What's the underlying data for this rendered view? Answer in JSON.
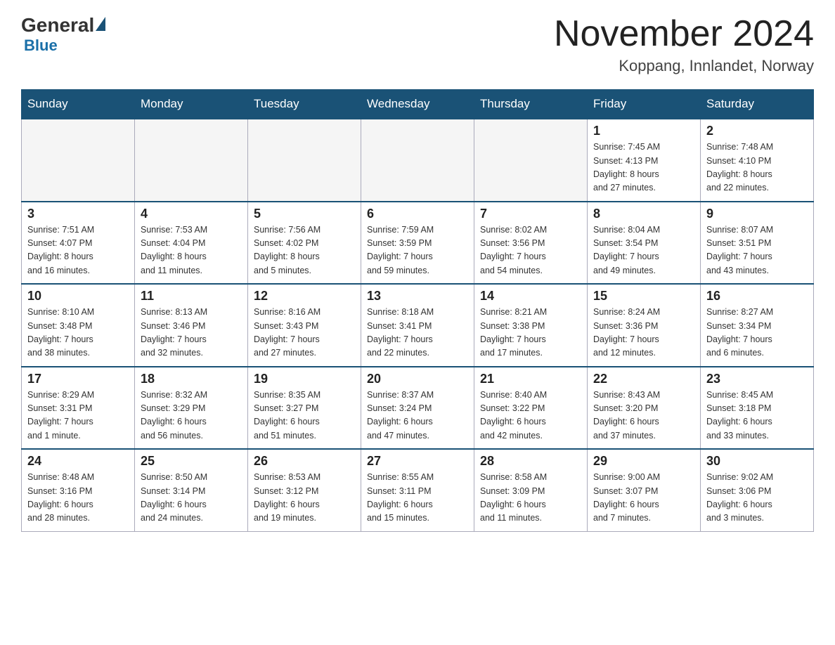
{
  "header": {
    "logo_general": "General",
    "logo_blue": "Blue",
    "title": "November 2024",
    "subtitle": "Koppang, Innlandet, Norway"
  },
  "days_of_week": [
    "Sunday",
    "Monday",
    "Tuesday",
    "Wednesday",
    "Thursday",
    "Friday",
    "Saturday"
  ],
  "weeks": [
    [
      {
        "day": "",
        "info": ""
      },
      {
        "day": "",
        "info": ""
      },
      {
        "day": "",
        "info": ""
      },
      {
        "day": "",
        "info": ""
      },
      {
        "day": "",
        "info": ""
      },
      {
        "day": "1",
        "info": "Sunrise: 7:45 AM\nSunset: 4:13 PM\nDaylight: 8 hours\nand 27 minutes."
      },
      {
        "day": "2",
        "info": "Sunrise: 7:48 AM\nSunset: 4:10 PM\nDaylight: 8 hours\nand 22 minutes."
      }
    ],
    [
      {
        "day": "3",
        "info": "Sunrise: 7:51 AM\nSunset: 4:07 PM\nDaylight: 8 hours\nand 16 minutes."
      },
      {
        "day": "4",
        "info": "Sunrise: 7:53 AM\nSunset: 4:04 PM\nDaylight: 8 hours\nand 11 minutes."
      },
      {
        "day": "5",
        "info": "Sunrise: 7:56 AM\nSunset: 4:02 PM\nDaylight: 8 hours\nand 5 minutes."
      },
      {
        "day": "6",
        "info": "Sunrise: 7:59 AM\nSunset: 3:59 PM\nDaylight: 7 hours\nand 59 minutes."
      },
      {
        "day": "7",
        "info": "Sunrise: 8:02 AM\nSunset: 3:56 PM\nDaylight: 7 hours\nand 54 minutes."
      },
      {
        "day": "8",
        "info": "Sunrise: 8:04 AM\nSunset: 3:54 PM\nDaylight: 7 hours\nand 49 minutes."
      },
      {
        "day": "9",
        "info": "Sunrise: 8:07 AM\nSunset: 3:51 PM\nDaylight: 7 hours\nand 43 minutes."
      }
    ],
    [
      {
        "day": "10",
        "info": "Sunrise: 8:10 AM\nSunset: 3:48 PM\nDaylight: 7 hours\nand 38 minutes."
      },
      {
        "day": "11",
        "info": "Sunrise: 8:13 AM\nSunset: 3:46 PM\nDaylight: 7 hours\nand 32 minutes."
      },
      {
        "day": "12",
        "info": "Sunrise: 8:16 AM\nSunset: 3:43 PM\nDaylight: 7 hours\nand 27 minutes."
      },
      {
        "day": "13",
        "info": "Sunrise: 8:18 AM\nSunset: 3:41 PM\nDaylight: 7 hours\nand 22 minutes."
      },
      {
        "day": "14",
        "info": "Sunrise: 8:21 AM\nSunset: 3:38 PM\nDaylight: 7 hours\nand 17 minutes."
      },
      {
        "day": "15",
        "info": "Sunrise: 8:24 AM\nSunset: 3:36 PM\nDaylight: 7 hours\nand 12 minutes."
      },
      {
        "day": "16",
        "info": "Sunrise: 8:27 AM\nSunset: 3:34 PM\nDaylight: 7 hours\nand 6 minutes."
      }
    ],
    [
      {
        "day": "17",
        "info": "Sunrise: 8:29 AM\nSunset: 3:31 PM\nDaylight: 7 hours\nand 1 minute."
      },
      {
        "day": "18",
        "info": "Sunrise: 8:32 AM\nSunset: 3:29 PM\nDaylight: 6 hours\nand 56 minutes."
      },
      {
        "day": "19",
        "info": "Sunrise: 8:35 AM\nSunset: 3:27 PM\nDaylight: 6 hours\nand 51 minutes."
      },
      {
        "day": "20",
        "info": "Sunrise: 8:37 AM\nSunset: 3:24 PM\nDaylight: 6 hours\nand 47 minutes."
      },
      {
        "day": "21",
        "info": "Sunrise: 8:40 AM\nSunset: 3:22 PM\nDaylight: 6 hours\nand 42 minutes."
      },
      {
        "day": "22",
        "info": "Sunrise: 8:43 AM\nSunset: 3:20 PM\nDaylight: 6 hours\nand 37 minutes."
      },
      {
        "day": "23",
        "info": "Sunrise: 8:45 AM\nSunset: 3:18 PM\nDaylight: 6 hours\nand 33 minutes."
      }
    ],
    [
      {
        "day": "24",
        "info": "Sunrise: 8:48 AM\nSunset: 3:16 PM\nDaylight: 6 hours\nand 28 minutes."
      },
      {
        "day": "25",
        "info": "Sunrise: 8:50 AM\nSunset: 3:14 PM\nDaylight: 6 hours\nand 24 minutes."
      },
      {
        "day": "26",
        "info": "Sunrise: 8:53 AM\nSunset: 3:12 PM\nDaylight: 6 hours\nand 19 minutes."
      },
      {
        "day": "27",
        "info": "Sunrise: 8:55 AM\nSunset: 3:11 PM\nDaylight: 6 hours\nand 15 minutes."
      },
      {
        "day": "28",
        "info": "Sunrise: 8:58 AM\nSunset: 3:09 PM\nDaylight: 6 hours\nand 11 minutes."
      },
      {
        "day": "29",
        "info": "Sunrise: 9:00 AM\nSunset: 3:07 PM\nDaylight: 6 hours\nand 7 minutes."
      },
      {
        "day": "30",
        "info": "Sunrise: 9:02 AM\nSunset: 3:06 PM\nDaylight: 6 hours\nand 3 minutes."
      }
    ]
  ]
}
